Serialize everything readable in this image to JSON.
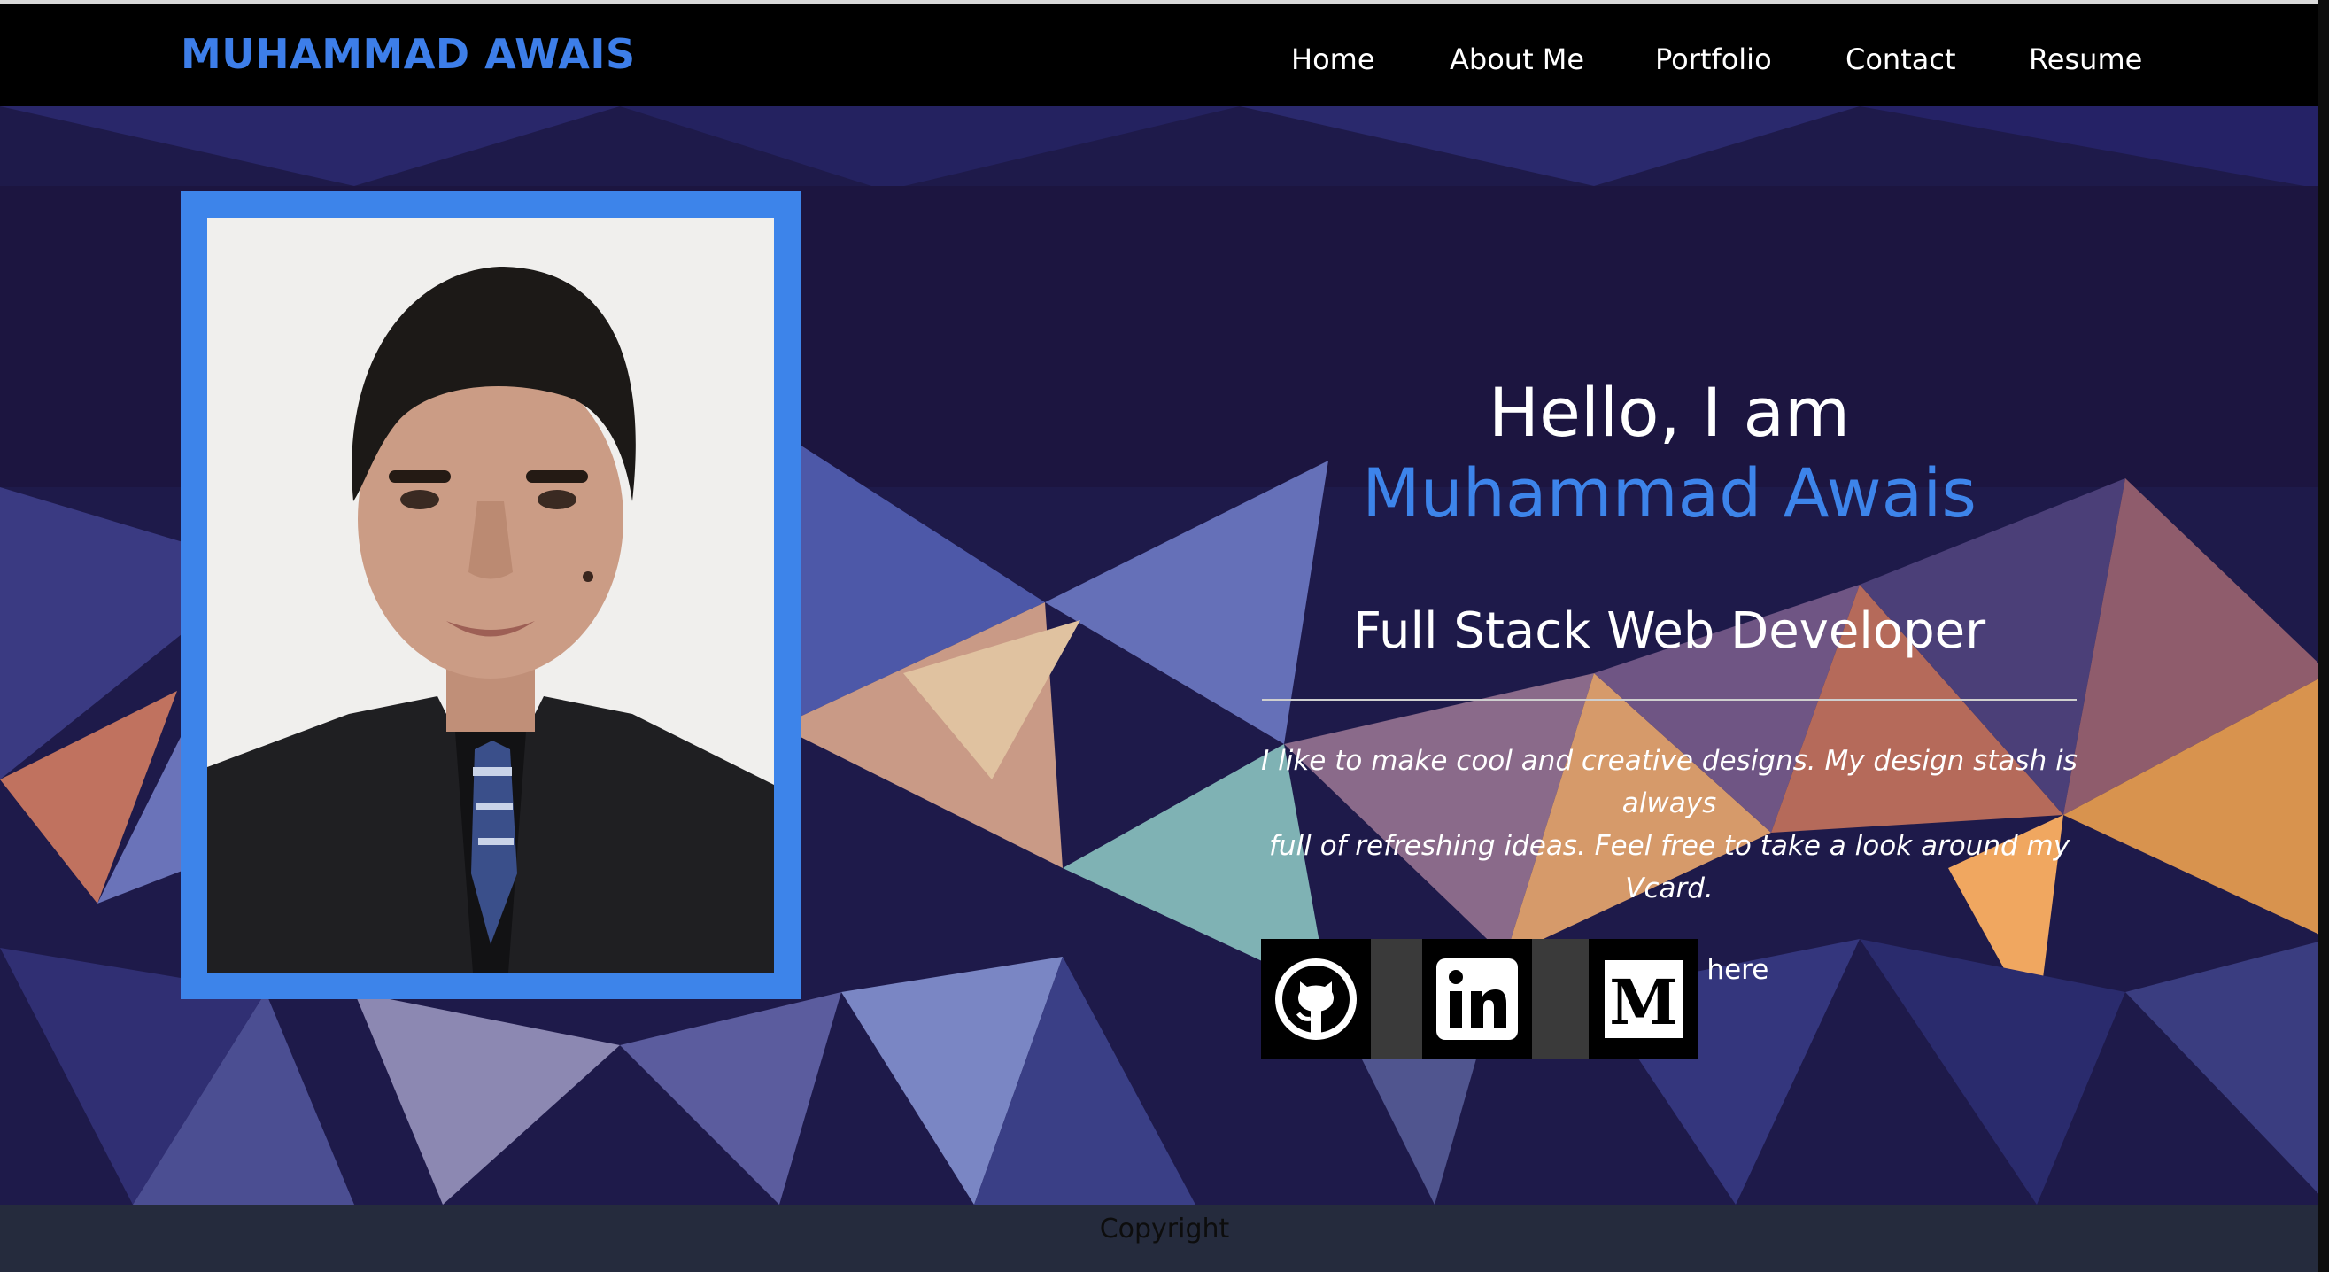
{
  "navbar": {
    "brand": "MUHAMMAD AWAIS",
    "items": [
      {
        "label": "Home"
      },
      {
        "label": "About Me"
      },
      {
        "label": "Portfolio"
      },
      {
        "label": "Contact"
      },
      {
        "label": "Resume"
      }
    ]
  },
  "intro": {
    "greeting": "Hello, I am",
    "name": "Muhammad Awais",
    "role": "Full Stack Web Developer",
    "description_line1": "I like to make cool and creative designs. My design stash is always",
    "description_line2": "full of refreshing ideas. Feel free to take a look around my Vcard.",
    "more_link": "More info here"
  },
  "socials": [
    {
      "icon": "github-icon"
    },
    {
      "icon": "linkedin-icon"
    },
    {
      "icon": "medium-icon"
    }
  ],
  "footer": {
    "text": "Copyright"
  },
  "colors": {
    "accent": "#3d84ea",
    "navbar": "#000000",
    "footer": "#252b3d"
  }
}
